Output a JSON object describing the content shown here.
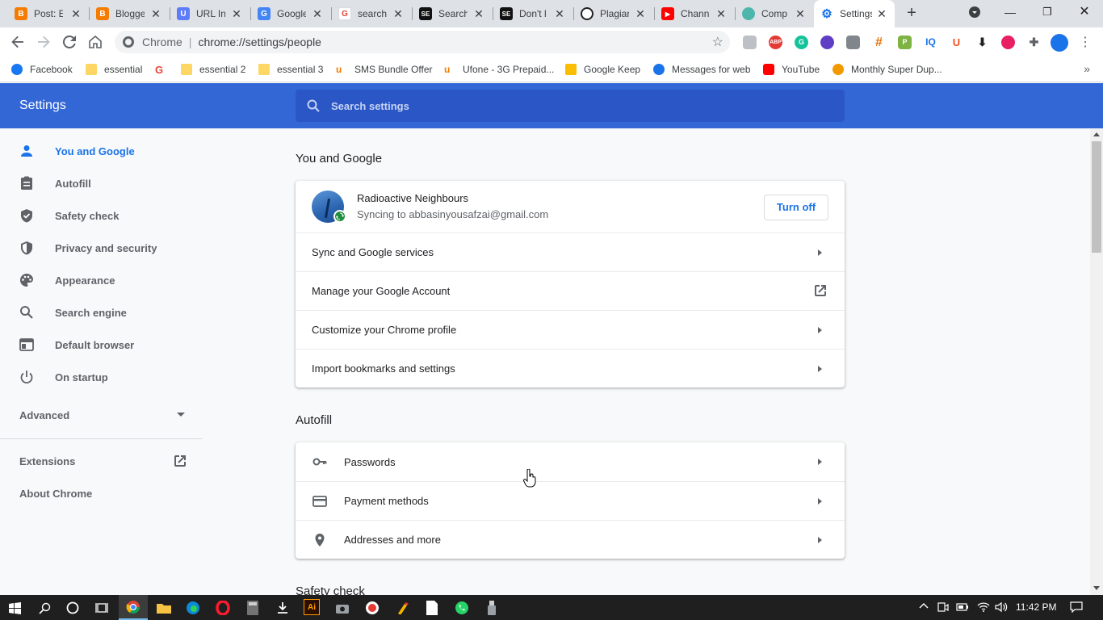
{
  "browser": {
    "tabs": [
      {
        "title": "Post: E",
        "favicon": "blogger-icon",
        "color": "#f57c00",
        "glyph": "B"
      },
      {
        "title": "Blogger",
        "favicon": "blogger-icon",
        "color": "#f57c00",
        "glyph": "B"
      },
      {
        "title": "URL In",
        "favicon": "url-icon",
        "color": "#5c7cfa",
        "glyph": "U"
      },
      {
        "title": "Google",
        "favicon": "google-slides-icon",
        "color": "#4285f4",
        "glyph": "G"
      },
      {
        "title": "search",
        "favicon": "google-icon",
        "color": "#ffffff",
        "glyph": "G"
      },
      {
        "title": "Search",
        "favicon": "sej-icon",
        "color": "#111111",
        "glyph": "SE"
      },
      {
        "title": "Don't l",
        "favicon": "sej-icon",
        "color": "#111111",
        "glyph": "SE"
      },
      {
        "title": "Plagiar",
        "favicon": "plagiarism-icon",
        "color": "#202124",
        "glyph": "Q"
      },
      {
        "title": "Chann",
        "favicon": "youtube-icon",
        "color": "#ff0000",
        "glyph": "▶"
      },
      {
        "title": "Comp",
        "favicon": "compressor-icon",
        "color": "#4db6ac",
        "glyph": "C"
      },
      {
        "title": "Settings",
        "favicon": "settings-gear-icon",
        "color": "#1a73e8",
        "glyph": "⚙",
        "active": true
      }
    ],
    "omnibox": {
      "scheme_label": "Chrome",
      "url": "chrome://settings/people"
    },
    "bookmarks": [
      {
        "label": "Facebook",
        "icon": "facebook-icon",
        "color": "#1877f2"
      },
      {
        "label": "essential",
        "icon": "folder-icon",
        "color": "#fdd663"
      },
      {
        "label": "",
        "icon": "google-icon",
        "color": "#ea4335"
      },
      {
        "label": "essential 2",
        "icon": "folder-icon",
        "color": "#fdd663"
      },
      {
        "label": "essential 3",
        "icon": "folder-icon",
        "color": "#fdd663"
      },
      {
        "label": "SMS Bundle Offer",
        "icon": "ufone-icon",
        "color": "#f57c00"
      },
      {
        "label": "Ufone - 3G Prepaid...",
        "icon": "ufone-icon",
        "color": "#f57c00"
      },
      {
        "label": "Google Keep",
        "icon": "google-keep-icon",
        "color": "#fbbc04"
      },
      {
        "label": "Messages for web",
        "icon": "messages-icon",
        "color": "#1a73e8"
      },
      {
        "label": "YouTube",
        "icon": "youtube-icon",
        "color": "#ff0000"
      },
      {
        "label": "Monthly Super Dup...",
        "icon": "offer-icon",
        "color": "#f29900"
      }
    ]
  },
  "settings": {
    "header_title": "Settings",
    "search_placeholder": "Search settings",
    "sidebar": {
      "items": [
        {
          "label": "You and Google",
          "icon": "person-icon",
          "selected": true
        },
        {
          "label": "Autofill",
          "icon": "clipboard-icon"
        },
        {
          "label": "Safety check",
          "icon": "shield-check-icon"
        },
        {
          "label": "Privacy and security",
          "icon": "shield-icon"
        },
        {
          "label": "Appearance",
          "icon": "palette-icon"
        },
        {
          "label": "Search engine",
          "icon": "search-icon"
        },
        {
          "label": "Default browser",
          "icon": "browser-icon"
        },
        {
          "label": "On startup",
          "icon": "power-icon"
        }
      ],
      "advanced_label": "Advanced",
      "extensions_label": "Extensions",
      "about_label": "About Chrome"
    },
    "you_and_google": {
      "section_title": "You and Google",
      "profile_name": "Radioactive Neighbours",
      "profile_sync": "Syncing to abbasinyousafzai@gmail.com",
      "turn_off_label": "Turn off",
      "rows": [
        {
          "label": "Sync and Google services"
        },
        {
          "label": "Manage your Google Account"
        },
        {
          "label": "Customize your Chrome profile"
        },
        {
          "label": "Import bookmarks and settings"
        }
      ]
    },
    "autofill": {
      "section_title": "Autofill",
      "rows": [
        {
          "label": "Passwords",
          "icon": "key-icon"
        },
        {
          "label": "Payment methods",
          "icon": "credit-card-icon"
        },
        {
          "label": "Addresses and more",
          "icon": "location-pin-icon"
        }
      ]
    },
    "safety_check": {
      "section_title": "Safety check"
    }
  },
  "taskbar": {
    "clock": "11:42 PM"
  },
  "colors": {
    "header_blue": "#3367d6",
    "accent": "#1a73e8"
  }
}
